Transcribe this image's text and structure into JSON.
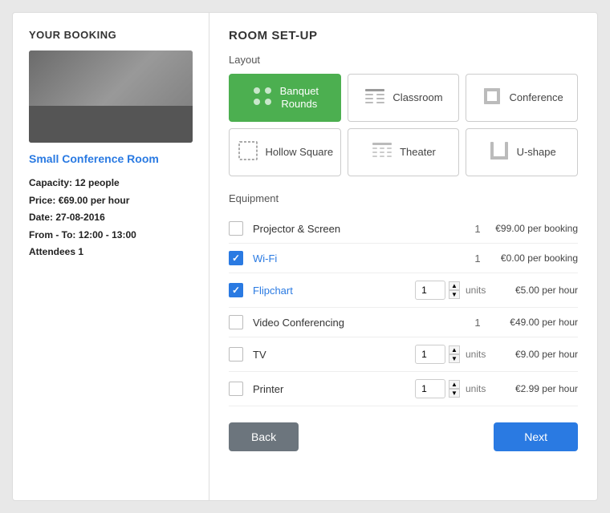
{
  "left_panel": {
    "title": "YOUR BOOKING",
    "room_name": "Small Conference Room",
    "details": {
      "capacity_label": "Capacity:",
      "capacity_value": "12 people",
      "price_label": "Price:",
      "price_value": "€69.00 per hour",
      "date_label": "Date:",
      "date_value": "27-08-2016",
      "from_to_label": "From - To:",
      "from_to_value": "12:00 - 13:00",
      "attendees_label": "Attendees",
      "attendees_value": "1"
    }
  },
  "right_panel": {
    "title": "ROOM SET-UP",
    "layout_label": "Layout",
    "layouts": [
      {
        "id": "banquet",
        "label": "Banquet\nRounds",
        "active": true,
        "icon": "banquet"
      },
      {
        "id": "classroom",
        "label": "Classroom",
        "active": false,
        "icon": "classroom"
      },
      {
        "id": "conference",
        "label": "Conference",
        "active": false,
        "icon": "conference"
      },
      {
        "id": "hollow-square",
        "label": "Hollow Square",
        "active": false,
        "icon": "hollow-square"
      },
      {
        "id": "theater",
        "label": "Theater",
        "active": false,
        "icon": "theater"
      },
      {
        "id": "u-shape",
        "label": "U-shape",
        "active": false,
        "icon": "u-shape"
      }
    ],
    "equipment_label": "Equipment",
    "equipment": [
      {
        "id": "projector",
        "label": "Projector & Screen",
        "link": false,
        "checked": false,
        "qty_type": "fixed",
        "qty": "1",
        "price": "€99.00 per booking"
      },
      {
        "id": "wifi",
        "label": "Wi-Fi",
        "link": true,
        "checked": true,
        "qty_type": "fixed",
        "qty": "1",
        "price": "€0.00 per booking"
      },
      {
        "id": "flipchart",
        "label": "Flipchart",
        "link": true,
        "checked": true,
        "qty_type": "stepper",
        "qty": "1",
        "units": "units",
        "price": "€5.00 per hour"
      },
      {
        "id": "video-conf",
        "label": "Video Conferencing",
        "link": false,
        "checked": false,
        "qty_type": "fixed",
        "qty": "1",
        "price": "€49.00 per hour"
      },
      {
        "id": "tv",
        "label": "TV",
        "link": false,
        "checked": false,
        "qty_type": "stepper",
        "qty": "1",
        "units": "units",
        "price": "€9.00 per hour"
      },
      {
        "id": "printer",
        "label": "Printer",
        "link": false,
        "checked": false,
        "qty_type": "stepper",
        "qty": "1",
        "units": "units",
        "price": "€2.99 per hour"
      }
    ],
    "buttons": {
      "back": "Back",
      "next": "Next"
    }
  }
}
